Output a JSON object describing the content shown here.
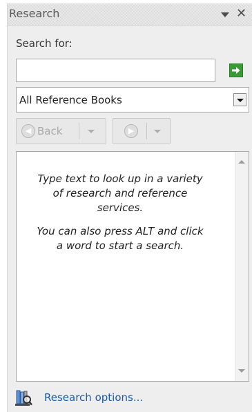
{
  "pane": {
    "title": "Research",
    "menu_icon": "dropdown-triangle-icon",
    "close_label": "✕"
  },
  "search": {
    "label": "Search for:",
    "value": "",
    "placeholder": "",
    "go_icon": "arrow-right-green-icon"
  },
  "reference": {
    "selected": "All Reference Books",
    "arrow_icon": "chevron-down-icon"
  },
  "navigation": {
    "back_label": "Back",
    "back_icon": "back-arrow-circle-icon",
    "forward_icon": "forward-arrow-circle-icon",
    "enabled": false
  },
  "results": {
    "message_1": "Type text to look up in a variety of research and reference services.",
    "message_2": "You can also press ALT and click a word to start a search."
  },
  "footer": {
    "options_label": "Research options...",
    "options_icon": "research-options-icon"
  },
  "colors": {
    "link": "#1d5aa8",
    "go_button": "#3a9a35",
    "pane_background": "#eeeeee"
  }
}
